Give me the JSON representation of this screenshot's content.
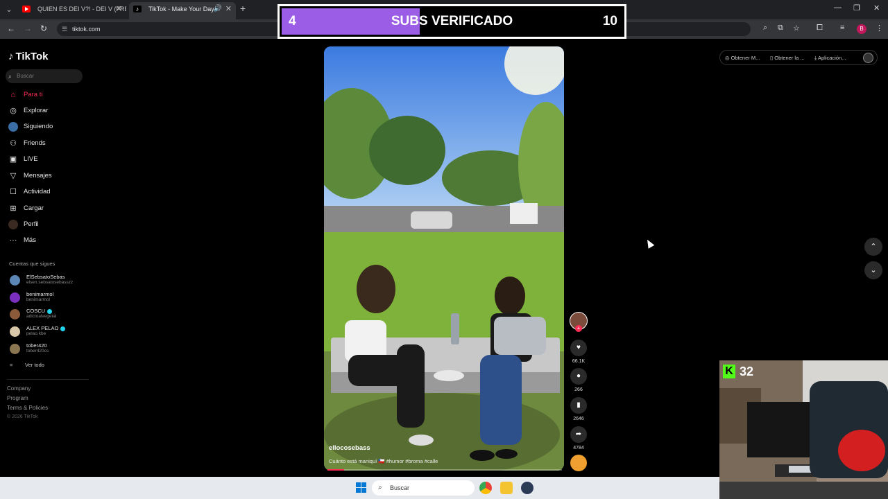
{
  "browser": {
    "tabs": [
      {
        "title": "QUIEN ES DEI V?! - DEI V (FREES"
      },
      {
        "title": "TikTok - Make Your Day"
      }
    ],
    "url": "tiktok.com"
  },
  "overlay": {
    "left_value": "4",
    "title": "SUBS VERIFICADO",
    "right_value": "10",
    "progress_fraction": 0.4,
    "fill_color": "#9b5de5"
  },
  "sidebar": {
    "logo": "TikTok",
    "search_placeholder": "Buscar",
    "menu": [
      {
        "label": "Para ti",
        "icon": "home-icon"
      },
      {
        "label": "Explorar",
        "icon": "compass-icon"
      },
      {
        "label": "Siguiendo",
        "icon": "following-avatar-icon"
      },
      {
        "label": "Friends",
        "icon": "friends-icon"
      },
      {
        "label": "LIVE",
        "icon": "live-icon"
      },
      {
        "label": "Mensajes",
        "icon": "paper-plane-icon"
      },
      {
        "label": "Actividad",
        "icon": "activity-icon"
      },
      {
        "label": "Cargar",
        "icon": "upload-icon"
      },
      {
        "label": "Perfil",
        "icon": "profile-avatar-icon"
      },
      {
        "label": "Más",
        "icon": "more-icon"
      }
    ],
    "following_label": "Cuentas que sigues",
    "accounts": [
      {
        "name": "ElSebsatoSebas",
        "handle": "elsen.sebsatosebasszz",
        "color": "#5b86b5"
      },
      {
        "name": "benimarmol",
        "handle": "benimarmol",
        "color": "#7b2fbf"
      },
      {
        "name": "COSCU",
        "handle": "adictoalvegetal",
        "color": "#8a5a3a",
        "verified": true
      },
      {
        "name": "ALEX PELAO",
        "handle": "pelao.kbe",
        "color": "#d8c7a8",
        "verified": true
      },
      {
        "name": "tober420",
        "handle": "tober420cs",
        "color": "#8a7650"
      }
    ],
    "see_all": "Ver todo",
    "footer": [
      "Company",
      "Program",
      "Terms & Policies"
    ],
    "copyright": "© 2026 TikTok"
  },
  "video": {
    "username": "ellocosebass",
    "caption": "Cuánto está maniquí 🇨🇱 #humor #broma #calle",
    "progress_fraction": 0.07
  },
  "actions": {
    "likes": "66.1K",
    "comments": "266",
    "saves": "2646",
    "shares": "4784"
  },
  "topright": {
    "items": [
      "Obtener M...",
      "Obtener la ...",
      "Aplicación..."
    ]
  },
  "webcam": {
    "kick_count": "32"
  },
  "taskbar": {
    "search_placeholder": "Buscar"
  }
}
